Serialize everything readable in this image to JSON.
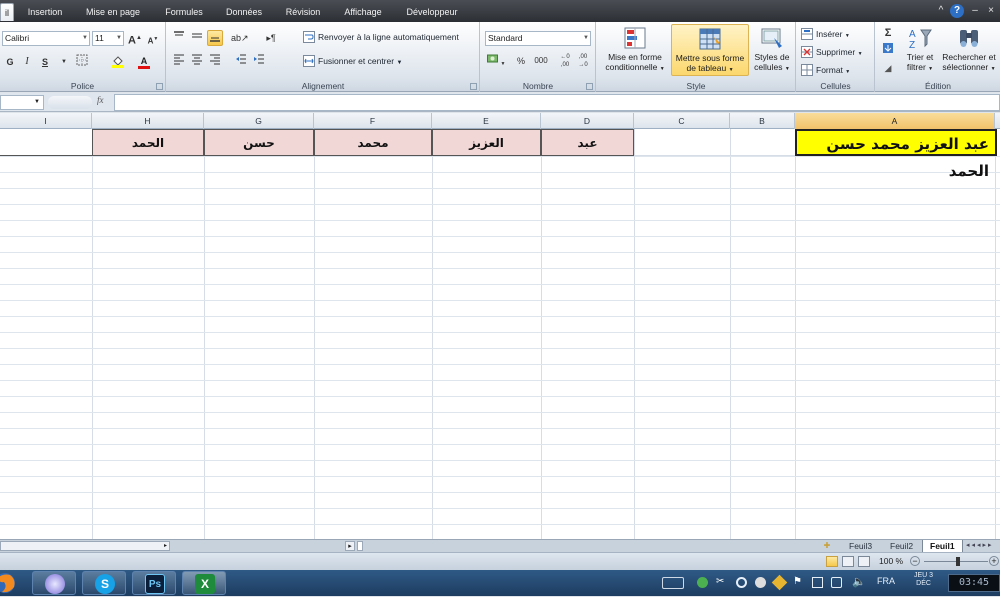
{
  "ribbon_tabs": [
    "il",
    "Insertion",
    "Mise en page",
    "Formules",
    "Données",
    "Révision",
    "Affichage",
    "Développeur"
  ],
  "window_controls": [
    "^",
    "?",
    "–",
    "×"
  ],
  "font_group": {
    "font_name": "Calibri",
    "font_size": "11",
    "grow_font": "A",
    "shrink_font": "A",
    "bold": "G",
    "italic": "I",
    "underline": "S",
    "font_color_letter": "A",
    "label": "Police"
  },
  "alignment_group": {
    "wrap_text": "Renvoyer à la ligne automatiquement",
    "merge_center": "Fusionner et centrer",
    "label": "Alignement"
  },
  "number_group": {
    "format": "Standard",
    "percent": "%",
    "thousands": "000",
    "label": "Nombre"
  },
  "style_group": {
    "conditional_format_1": "Mise en forme",
    "conditional_format_2": "conditionnelle",
    "format_as_table_1": "Mettre sous forme",
    "format_as_table_2": "de tableau",
    "cell_styles_1": "Styles de",
    "cell_styles_2": "cellules",
    "label": "Style"
  },
  "cells_group": {
    "insert": "Insérer",
    "delete": "Supprimer",
    "format": "Format",
    "label": "Cellules"
  },
  "editing_group": {
    "sum": "Σ",
    "sort_1": "Trier et",
    "sort_2": "filtrer",
    "find_1": "Rechercher et",
    "find_2": "sélectionner",
    "label": "Édition"
  },
  "formula_bar": {
    "fx": "fx",
    "content": ""
  },
  "columns": [
    "I",
    "H",
    "G",
    "F",
    "E",
    "D",
    "C",
    "B",
    "A"
  ],
  "cells": {
    "A1": "عبد العزيز محمد حسن الحمد",
    "D1": "عبد",
    "E1": "العزيز",
    "F1": "محمد",
    "G1": "حسن",
    "H1": "الحمد"
  },
  "sheet_tabs": [
    "Feuil3",
    "Feuil2",
    "Feuil1"
  ],
  "active_sheet": "Feuil1",
  "zoom": "100 %",
  "taskbar": {
    "apps": [
      "firefox-icon",
      "itunes-icon",
      "skype-icon",
      "photoshop-icon",
      "excel-icon"
    ],
    "ps_label": "Ps",
    "skype_label": "S",
    "excel_label": "X",
    "language": "FRA",
    "date_line1": "JEU 3",
    "date_line2": "DÉC",
    "clock": "03:45"
  },
  "colors": {
    "header_fill": "#f2d7d7",
    "highlight_fill": "#ffff00",
    "ribbon_tab_bg": "#2c2f34",
    "taskbar_bg": "#1d3c60"
  }
}
